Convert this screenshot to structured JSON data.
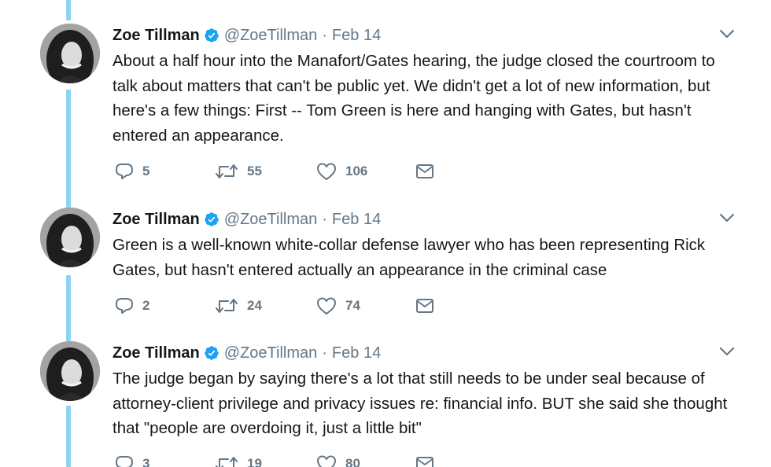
{
  "colors": {
    "thread_line": "#8fd3f4",
    "muted": "#657786",
    "verified": "#1da1f2",
    "text": "#14171a"
  },
  "icons": {
    "reply": "reply-icon",
    "retweet": "retweet-icon",
    "like": "like-icon",
    "dm": "direct-message-icon",
    "verified": "verified-badge-icon",
    "caret": "chevron-down-icon"
  },
  "tweets": [
    {
      "name": "Zoe Tillman",
      "handle": "@ZoeTillman",
      "separator": "·",
      "date": "Feb 14",
      "text": "About a half hour into the Manafort/Gates hearing, the judge closed the courtroom to talk about matters that can't be public yet. We didn't get a lot of new information, but here's a few things: First -- Tom Green is here and hanging with Gates, but hasn't entered an appearance.",
      "replies": "5",
      "retweets": "55",
      "likes": "106"
    },
    {
      "name": "Zoe Tillman",
      "handle": "@ZoeTillman",
      "separator": "·",
      "date": "Feb 14",
      "text": "Green is a well-known white-collar defense lawyer who has been representing Rick Gates, but hasn't entered actually an appearance in the criminal case",
      "replies": "2",
      "retweets": "24",
      "likes": "74"
    },
    {
      "name": "Zoe Tillman",
      "handle": "@ZoeTillman",
      "separator": "·",
      "date": "Feb 14",
      "text": "The judge began by saying there's a lot that still needs to be under seal because of attorney-client privilege and privacy issues re: financial info. BUT she said she thought that \"people are overdoing it, just a little bit\"",
      "replies": "3",
      "retweets": "19",
      "likes": "80"
    }
  ]
}
